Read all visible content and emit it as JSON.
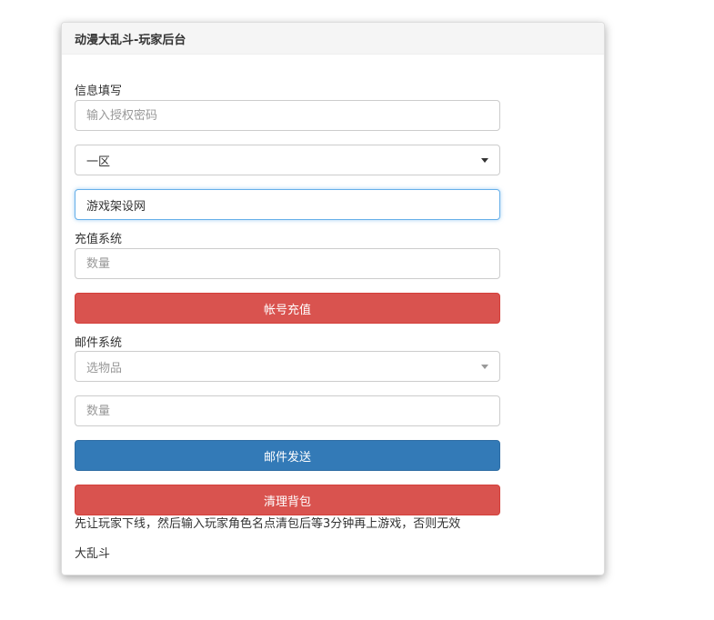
{
  "panel": {
    "title": "动漫大乱斗-玩家后台"
  },
  "info_section": {
    "label": "信息填写",
    "password_placeholder": "输入授权密码",
    "server_select_value": "一区",
    "account_value": "游戏架设网"
  },
  "recharge_section": {
    "label": "充值系统",
    "amount_placeholder": "数量",
    "recharge_button": "帐号充值"
  },
  "mail_section": {
    "label": "邮件系统",
    "item_select_placeholder": "选物品",
    "amount_placeholder": "数量",
    "send_button": "邮件发送",
    "clear_bag_button": "清理背包"
  },
  "notice": "先让玩家下线，然后输入玩家角色名点清包后等3分钟再上游戏，否则无效",
  "footer": "大乱斗",
  "colors": {
    "danger": "#d9534f",
    "primary": "#337ab7",
    "focus": "#66afe9"
  }
}
